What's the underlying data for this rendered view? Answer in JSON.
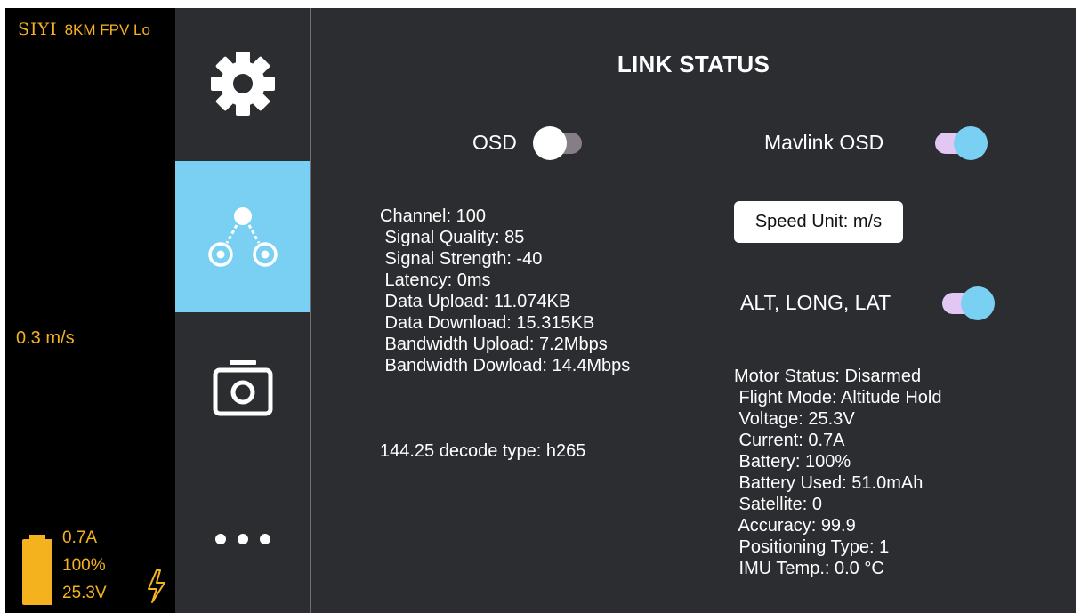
{
  "video": {
    "brand_logo": "SIYI",
    "brand_text": "8KM FPV Lo",
    "speed": "0.3 m/s",
    "battery": {
      "current": "0.7A",
      "percent": "100%",
      "voltage": "25.3V",
      "level": 1.0
    },
    "colors": {
      "osd_text": "#f5b21f"
    }
  },
  "sidebar": {
    "items": [
      {
        "icon": "gear-icon",
        "active": false
      },
      {
        "icon": "link-nodes-icon",
        "active": true
      },
      {
        "icon": "camera-icon",
        "active": false
      },
      {
        "icon": "more-dots-icon",
        "active": false
      }
    ],
    "colors": {
      "active_bg": "#79d0f2"
    }
  },
  "main": {
    "title": "LINK STATUS",
    "osd": {
      "label": "OSD",
      "on": false
    },
    "mavlink_osd": {
      "label": "Mavlink OSD",
      "on": true
    },
    "link_info": [
      "Channel: 100",
      " Signal Quality: 85",
      " Signal Strength: -40",
      " Latency: 0ms",
      " Data Upload: 11.074KB",
      " Data Download: 15.315KB",
      " Bandwidth Upload: 7.2Mbps",
      " Bandwidth Dowload: 14.4Mbps"
    ],
    "decode": "144.25 decode type: h265",
    "speed_unit": "Speed Unit: m/s",
    "alt_long_lat": {
      "label": "ALT, LONG, LAT",
      "on": true
    },
    "flight_info": [
      "Motor Status: Disarmed",
      " Flight Mode: Altitude Hold",
      " Voltage: 25.3V",
      " Current: 0.7A",
      " Battery: 100%",
      " Battery Used: 51.0mAh",
      " Satellite: 0",
      " Accuracy: 99.9",
      " Positioning Type: 1",
      " IMU Temp.: 0.0 °C"
    ],
    "colors": {
      "background": "#2b2d31",
      "toggle_on_knob": "#79d0f2",
      "toggle_on_track": "#e2c7f2"
    }
  }
}
